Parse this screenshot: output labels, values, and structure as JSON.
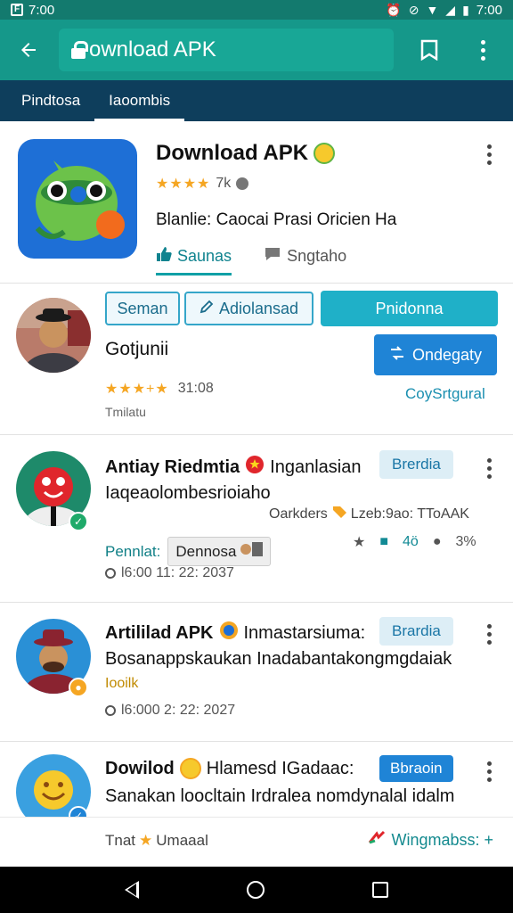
{
  "status_bar": {
    "left_time": "7:00",
    "right_time": "7:00"
  },
  "app_bar": {
    "url": "ownload APK"
  },
  "tabs": [
    {
      "label": "Pindtosa"
    },
    {
      "label": "Iaoombis"
    }
  ],
  "app": {
    "title": "Download APK",
    "stars": "★★★★",
    "rating_text": "7k",
    "description": "Blanlie: Caocai Prasi Oricien Ha",
    "tab_active": "Saunas",
    "tab_inactive": "Sngtaho"
  },
  "developer": {
    "chip1": "Seman",
    "chip2": "Adiolansad",
    "chip3": "Pnidonna",
    "name": "Gotjunii",
    "button": "Ondegaty",
    "stars": "★★★+★",
    "stars_count": "31:08",
    "subtitle": "Tmilatu",
    "link": "CoySrtgural"
  },
  "reviews": [
    {
      "title_bold": "Antiay Riedmtia",
      "title_rest": "Inganlasian",
      "badge": "Brerdia",
      "body": "Iaqeaolombesrioiaho",
      "meta": "Oarkders",
      "meta_tail": "Lzeb:9ao: TToAAK",
      "tag_label": "Pennlat:",
      "tag_chip": "Dennosa",
      "stat1": "4ö",
      "stat2": "3%",
      "date": "l6:00 11: 22: 2037"
    },
    {
      "title_bold": "Artililad APK",
      "title_rest": "Inmastarsiuma:",
      "badge": "Brardia",
      "body": "Bosanappskaukan Inadabantakongmgdaiak",
      "extra": "Iooilk",
      "date": "l6:000 2: 22: 2027"
    },
    {
      "title_bold": "Dowilod",
      "title_rest": "Hlamesd IGadaac:",
      "badge": "Bbraoin",
      "body": "Sanakan loocltain Irdralea nomdynalal idalm"
    }
  ],
  "bottom": {
    "left": "Tnat",
    "left_tail": "Umaaal",
    "right": "Wingmabss: +"
  },
  "colors": {
    "app_bar": "#15988a",
    "tab_strip": "#0e3e5c",
    "accent": "#1f84d6",
    "teal": "#1fb0c8"
  }
}
